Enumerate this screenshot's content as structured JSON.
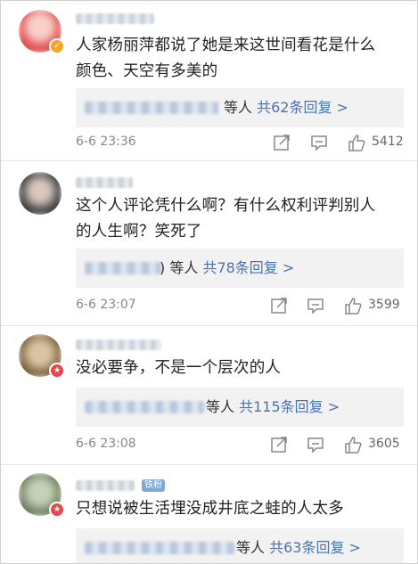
{
  "comments": [
    {
      "text_line1": "人家杨丽萍都说了她是来这世间看花是什么",
      "text_line2": "颜色、天空有多美的",
      "reply_suffix": "等人",
      "reply_count": "共62条回复 >",
      "time": "6-6 23:36",
      "likes": "5412",
      "avatar_color": "#e45a5a",
      "badge": "gold"
    },
    {
      "text_line1": "这个人评论凭什么啊？有什么权利评判别人",
      "text_line2": "的人生啊？笑死了",
      "reply_suffix": ") 等人",
      "reply_count": "共78条回复 >",
      "time": "6-6 23:07",
      "likes": "3599",
      "avatar_color": "#4a4a4a"
    },
    {
      "text_line1": "没必要争，不是一个层次的人",
      "reply_suffix": "等人",
      "reply_count": "共115条回复 >",
      "time": "6-6 23:08",
      "likes": "3605",
      "avatar_color": "#8a6d4a",
      "badge": "red"
    },
    {
      "text_line1": "只想说被生活埋没成井底之蛙的人太多",
      "level_badge": "铁粉",
      "reply_suffix": "等人",
      "reply_count": "共63条回复 >",
      "avatar_color": "#7a8a6a",
      "badge": "red"
    }
  ],
  "icons": {
    "share": "share-icon",
    "comment": "comment-icon",
    "like": "thumbs-up-icon"
  }
}
